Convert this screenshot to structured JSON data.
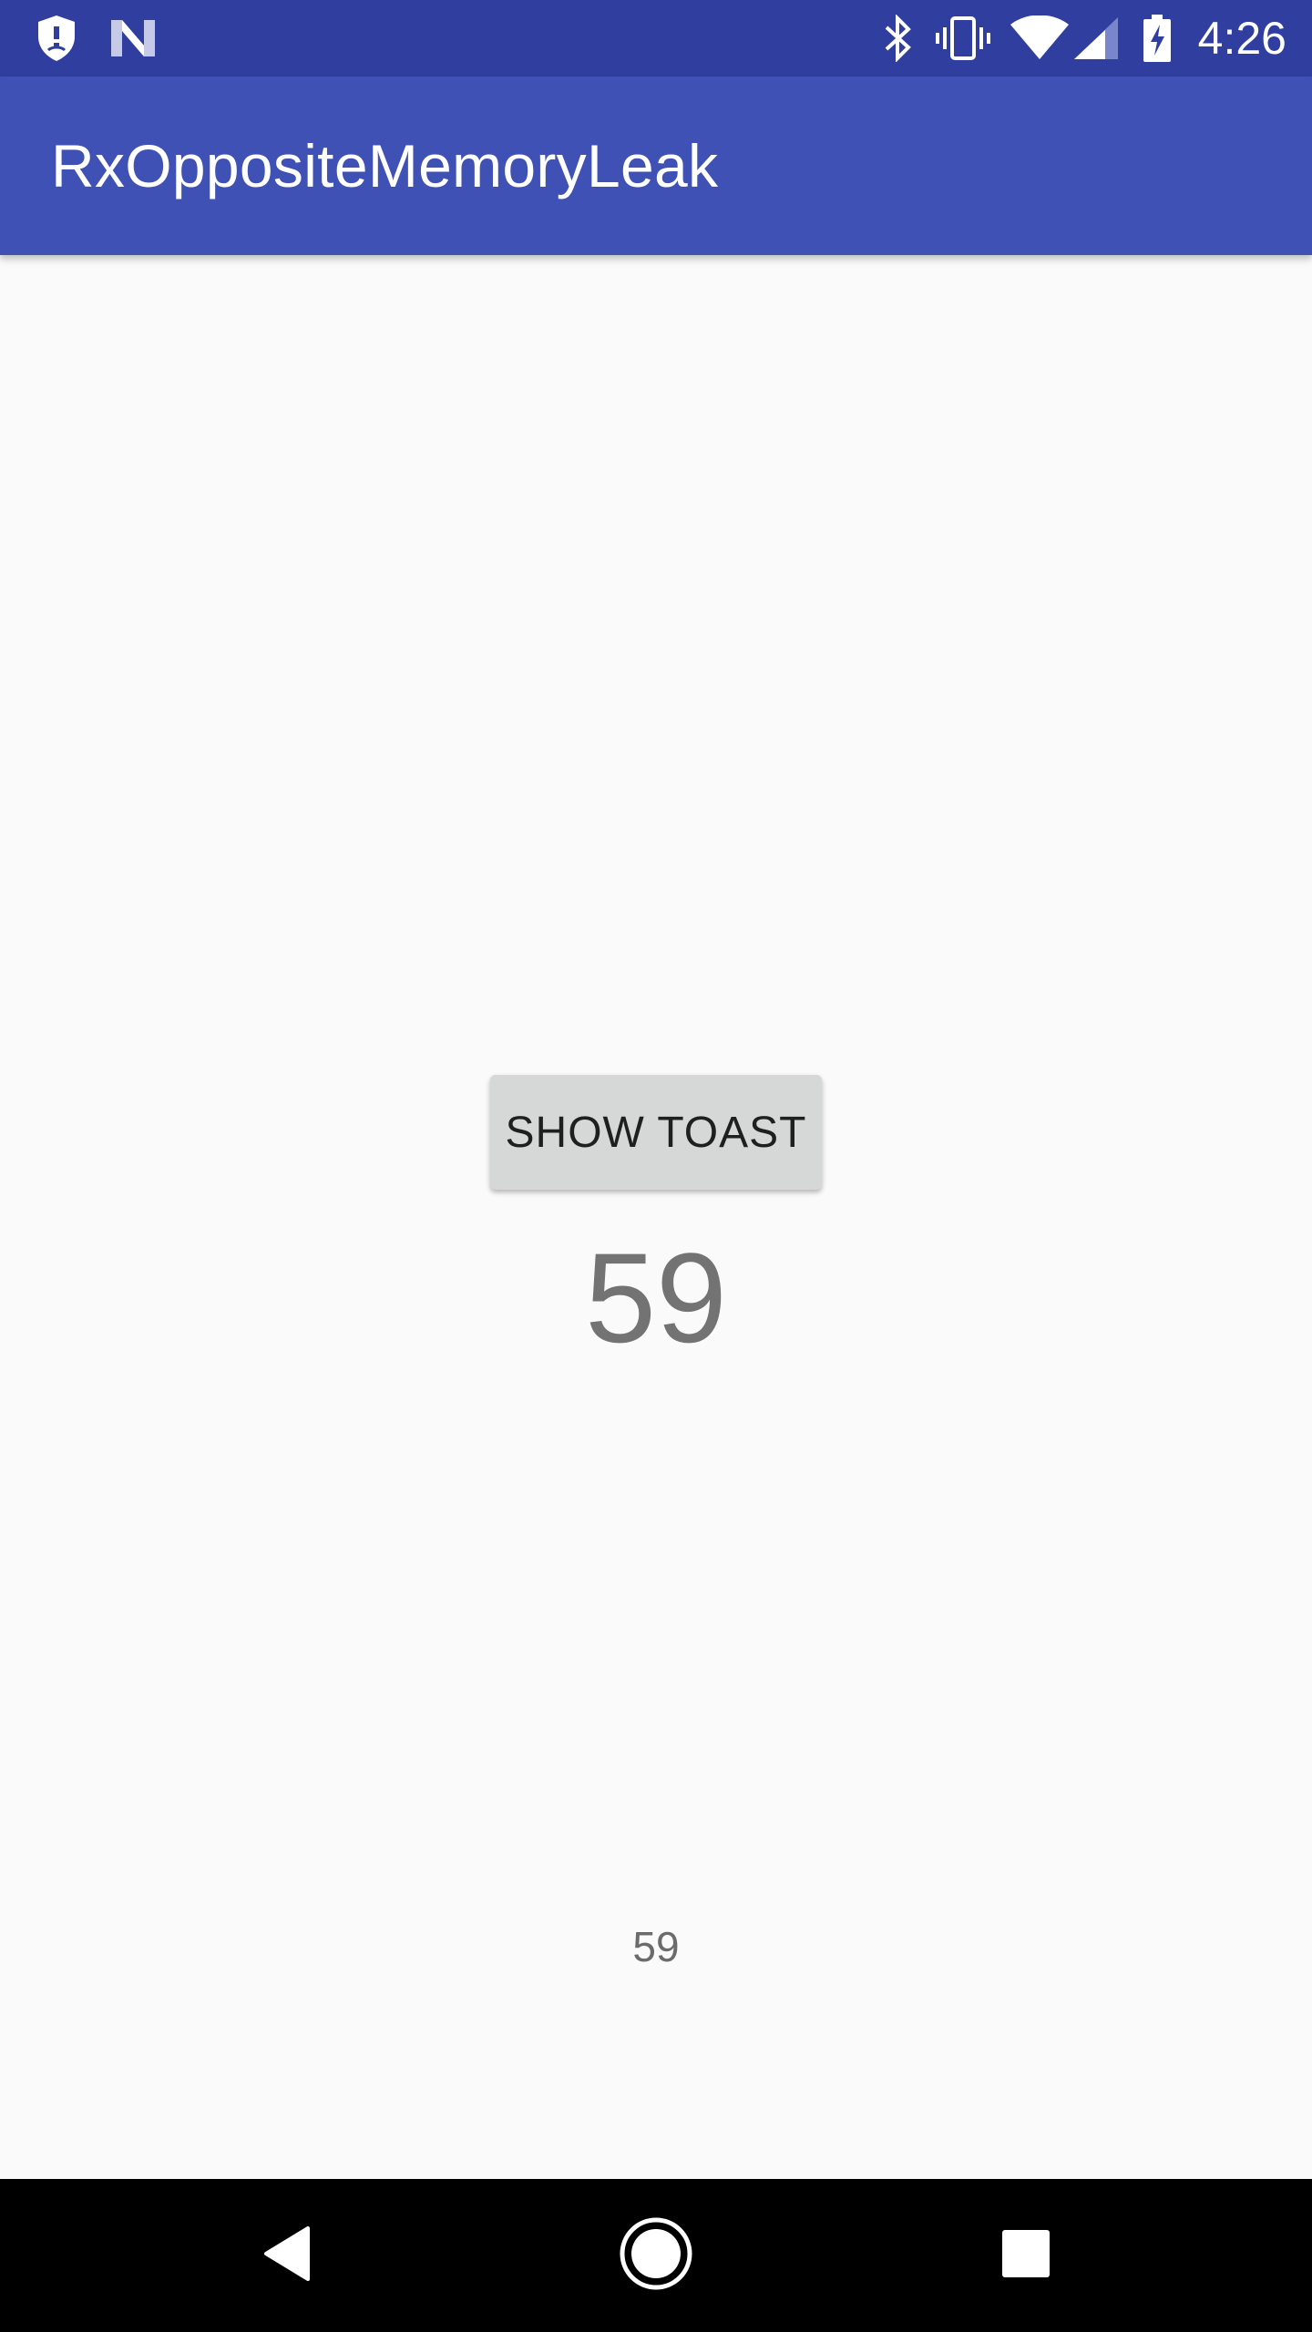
{
  "status_bar": {
    "time": "4:26",
    "left_icons": [
      "shield-notification-icon",
      "n-notification-icon"
    ],
    "right_icons": [
      "bluetooth-icon",
      "vibrate-icon",
      "wifi-icon",
      "cell-signal-icon",
      "battery-charging-icon"
    ],
    "background_color": "#303f9f"
  },
  "app_bar": {
    "title": "RxOppositeMemoryLeak",
    "background_color": "#3f51b5"
  },
  "main": {
    "button_label": "SHOW TOAST",
    "counter_value": "59"
  },
  "toast": {
    "text": "59"
  },
  "nav_bar": {
    "buttons": [
      "back-icon",
      "home-icon",
      "recents-icon"
    ]
  }
}
